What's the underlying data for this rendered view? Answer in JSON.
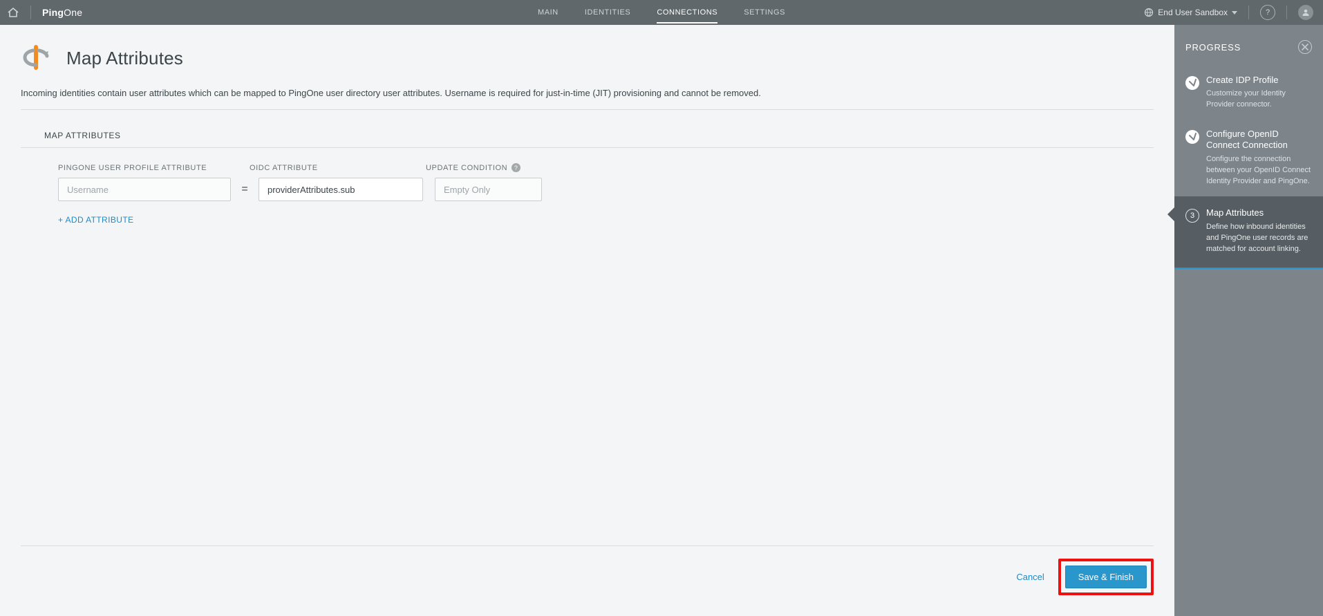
{
  "topnav": {
    "brand_light": "Ping",
    "brand_bold": "One",
    "links": [
      {
        "label": "MAIN",
        "active": false
      },
      {
        "label": "IDENTITIES",
        "active": false
      },
      {
        "label": "CONNECTIONS",
        "active": true
      },
      {
        "label": "SETTINGS",
        "active": false
      }
    ],
    "environment": "End User Sandbox"
  },
  "page": {
    "title": "Map Attributes",
    "description": "Incoming identities contain user attributes which can be mapped to PingOne user directory user attributes. Username is required for just-in-time (JIT) provisioning and cannot be removed.",
    "section_title": "MAP ATTRIBUTES",
    "columns": {
      "profile": "PINGONE USER PROFILE ATTRIBUTE",
      "oidc": "OIDC ATTRIBUTE",
      "update": "UPDATE CONDITION"
    },
    "row": {
      "profile_value": "Username",
      "equals": "=",
      "oidc_value": "providerAttributes.sub",
      "update_value": "Empty Only"
    },
    "add_attribute": "+ ADD ATTRIBUTE",
    "buttons": {
      "cancel": "Cancel",
      "save": "Save & Finish"
    }
  },
  "sidebar": {
    "title": "PROGRESS",
    "steps": [
      {
        "num": 1,
        "done": true,
        "title": "Create IDP Profile",
        "desc": "Customize your Identity Provider connector."
      },
      {
        "num": 2,
        "done": true,
        "title": "Configure OpenID Connect Connection",
        "desc": "Configure the connection between your OpenID Connect Identity Provider and PingOne."
      },
      {
        "num": 3,
        "done": false,
        "active": true,
        "title": "Map Attributes",
        "desc": "Define how inbound identities and PingOne user records are matched for account linking."
      }
    ]
  }
}
